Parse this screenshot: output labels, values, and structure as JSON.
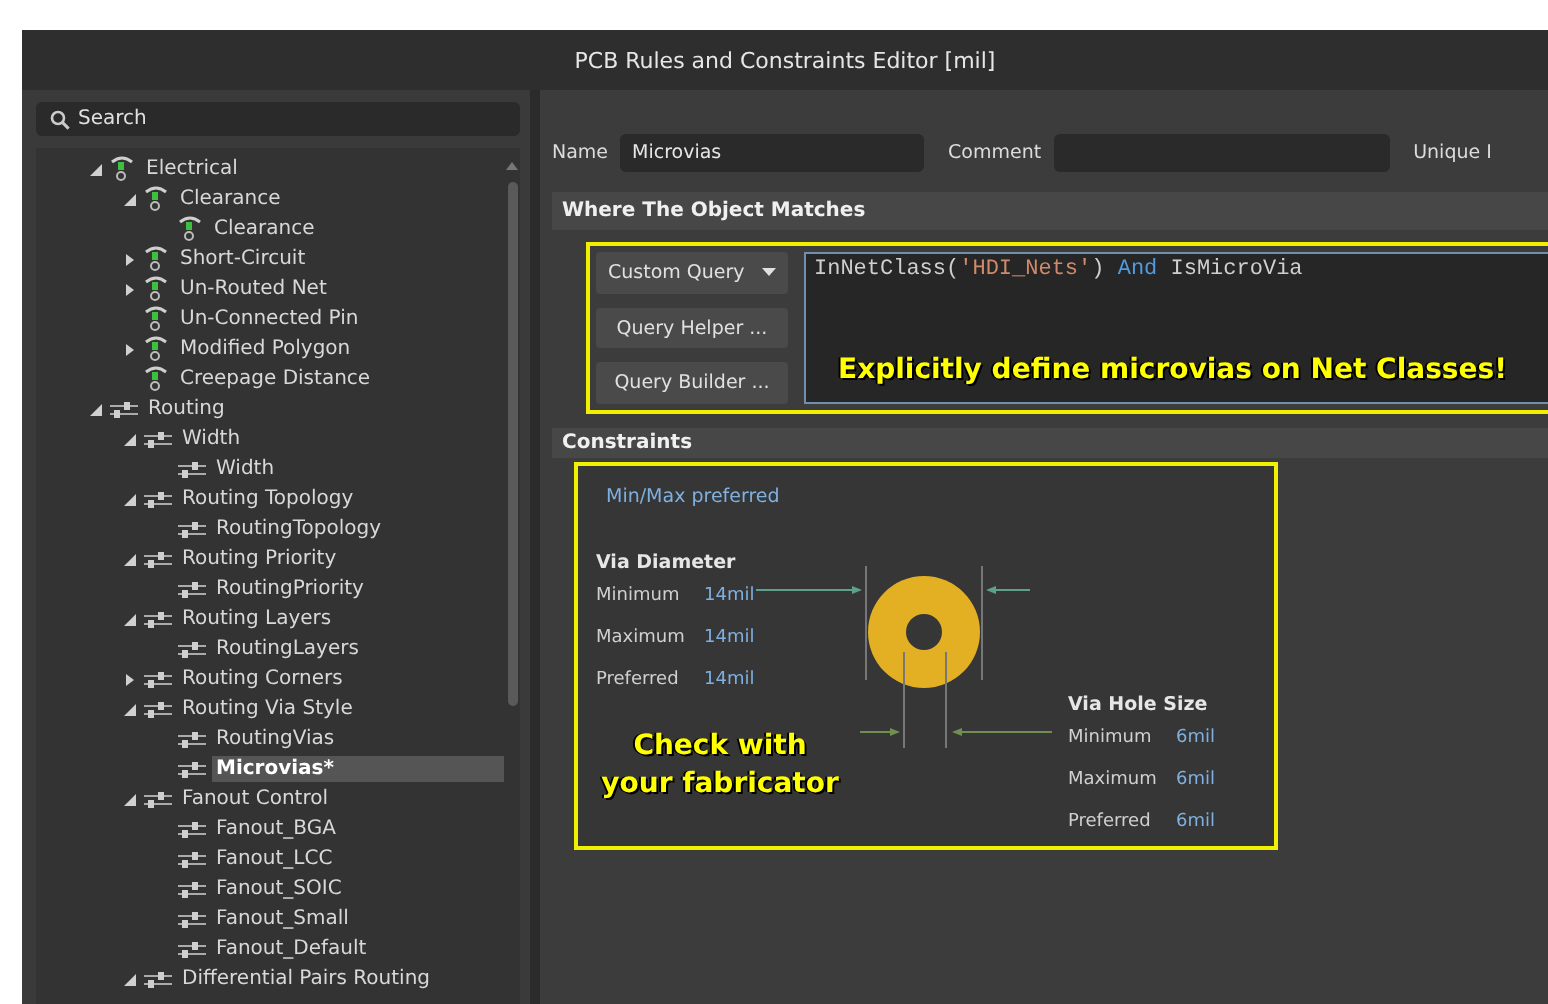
{
  "window": {
    "title": "PCB Rules and Constraints Editor [mil]"
  },
  "search": {
    "placeholder": "Search"
  },
  "tree": [
    {
      "label": "Electrical",
      "kind": "electrical",
      "expanded": true,
      "selected": false,
      "children": [
        {
          "label": "Clearance",
          "kind": "electrical",
          "expanded": true,
          "selected": false,
          "children": [
            {
              "label": "Clearance",
              "kind": "electrical",
              "selected": false
            }
          ]
        },
        {
          "label": "Short-Circuit",
          "kind": "electrical",
          "expanded": false,
          "selected": false
        },
        {
          "label": "Un-Routed Net",
          "kind": "electrical",
          "expanded": false,
          "selected": false
        },
        {
          "label": "Un-Connected Pin",
          "kind": "electrical",
          "selected": false
        },
        {
          "label": "Modified Polygon",
          "kind": "electrical",
          "expanded": false,
          "selected": false
        },
        {
          "label": "Creepage Distance",
          "kind": "electrical",
          "selected": false
        }
      ]
    },
    {
      "label": "Routing",
      "kind": "routing",
      "expanded": true,
      "selected": false,
      "children": [
        {
          "label": "Width",
          "kind": "routing",
          "expanded": true,
          "selected": false,
          "children": [
            {
              "label": "Width",
              "kind": "routing",
              "selected": false
            }
          ]
        },
        {
          "label": "Routing Topology",
          "kind": "routing",
          "expanded": true,
          "selected": false,
          "children": [
            {
              "label": "RoutingTopology",
              "kind": "routing",
              "selected": false
            }
          ]
        },
        {
          "label": "Routing Priority",
          "kind": "routing",
          "expanded": true,
          "selected": false,
          "children": [
            {
              "label": "RoutingPriority",
              "kind": "routing",
              "selected": false
            }
          ]
        },
        {
          "label": "Routing Layers",
          "kind": "routing",
          "expanded": true,
          "selected": false,
          "children": [
            {
              "label": "RoutingLayers",
              "kind": "routing",
              "selected": false
            }
          ]
        },
        {
          "label": "Routing Corners",
          "kind": "routing",
          "expanded": false,
          "selected": false
        },
        {
          "label": "Routing Via Style",
          "kind": "routing",
          "expanded": true,
          "selected": false,
          "children": [
            {
              "label": "RoutingVias",
              "kind": "routing",
              "selected": false
            },
            {
              "label": "Microvias*",
              "kind": "routing",
              "selected": true
            }
          ]
        },
        {
          "label": "Fanout Control",
          "kind": "routing",
          "expanded": true,
          "selected": false,
          "children": [
            {
              "label": "Fanout_BGA",
              "kind": "routing",
              "selected": false
            },
            {
              "label": "Fanout_LCC",
              "kind": "routing",
              "selected": false
            },
            {
              "label": "Fanout_SOIC",
              "kind": "routing",
              "selected": false
            },
            {
              "label": "Fanout_Small",
              "kind": "routing",
              "selected": false
            },
            {
              "label": "Fanout_Default",
              "kind": "routing",
              "selected": false
            }
          ]
        },
        {
          "label": "Differential Pairs Routing",
          "kind": "routing",
          "expanded": true,
          "selected": false
        }
      ]
    }
  ],
  "rule": {
    "name_label": "Name",
    "name": "Microvias",
    "comment_label": "Comment",
    "unique_id_label": "Unique I"
  },
  "where_section": {
    "title": "Where The Object Matches",
    "query_type": "Custom Query",
    "buttons": [
      "Query Helper ...",
      "Query Builder ..."
    ],
    "query": [
      {
        "text": "InNetClass(",
        "kind": "plain"
      },
      {
        "text": "'HDI_Nets'",
        "kind": "string"
      },
      {
        "text": ") ",
        "kind": "plain"
      },
      {
        "text": "And",
        "kind": "keyword"
      },
      {
        "text": " IsMicroVia",
        "kind": "plain"
      }
    ],
    "callout": "Explicitly define microvias on Net Classes!"
  },
  "constraints": {
    "title": "Constraints",
    "mode": "Min/Max preferred",
    "via_diameter": {
      "title": "Via Diameter",
      "rows": [
        {
          "label": "Minimum",
          "value": "14mil"
        },
        {
          "label": "Maximum",
          "value": "14mil"
        },
        {
          "label": "Preferred",
          "value": "14mil"
        }
      ]
    },
    "via_hole_size": {
      "title": "Via Hole Size",
      "rows": [
        {
          "label": "Minimum",
          "value": "6mil"
        },
        {
          "label": "Maximum",
          "value": "6mil"
        },
        {
          "label": "Preferred",
          "value": "6mil"
        }
      ]
    },
    "callout": "Check with your fabricator"
  }
}
